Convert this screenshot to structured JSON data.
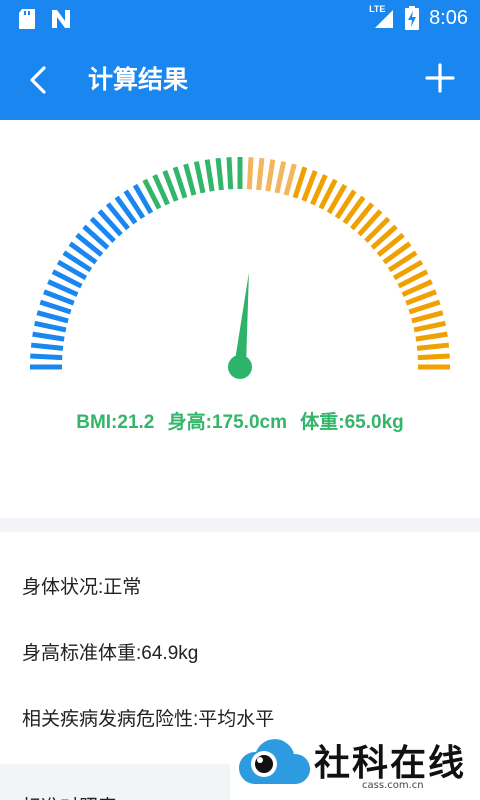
{
  "status_bar": {
    "time": "8:06",
    "network_label": "LTE",
    "icons": [
      "sd-card-icon",
      "n-notification-icon",
      "lte-signal-icon",
      "battery-charging-icon"
    ]
  },
  "app_bar": {
    "title": "计算结果",
    "back_icon": "chevron-left-icon",
    "add_icon": "plus-icon"
  },
  "gauge": {
    "value": 21.2,
    "min": 0,
    "max": 40,
    "colors": {
      "low": "#1a87f0",
      "normal": "#33b56a",
      "high_light": "#f3b55e",
      "high": "#f0a000",
      "needle": "#2db36a"
    }
  },
  "summary": {
    "bmi": "BMI:21.2",
    "height": "身高:175.0cm",
    "weight": "体重:65.0kg"
  },
  "details": {
    "condition": "身体状况:正常",
    "standard_weight": "身高标准体重:64.9kg",
    "risk": "相关疾病发病危险性:平均水平"
  },
  "bottom_section": {
    "label": "标准对照表"
  },
  "watermark": {
    "text": "社科在线",
    "domain": "cass.com.cn"
  }
}
